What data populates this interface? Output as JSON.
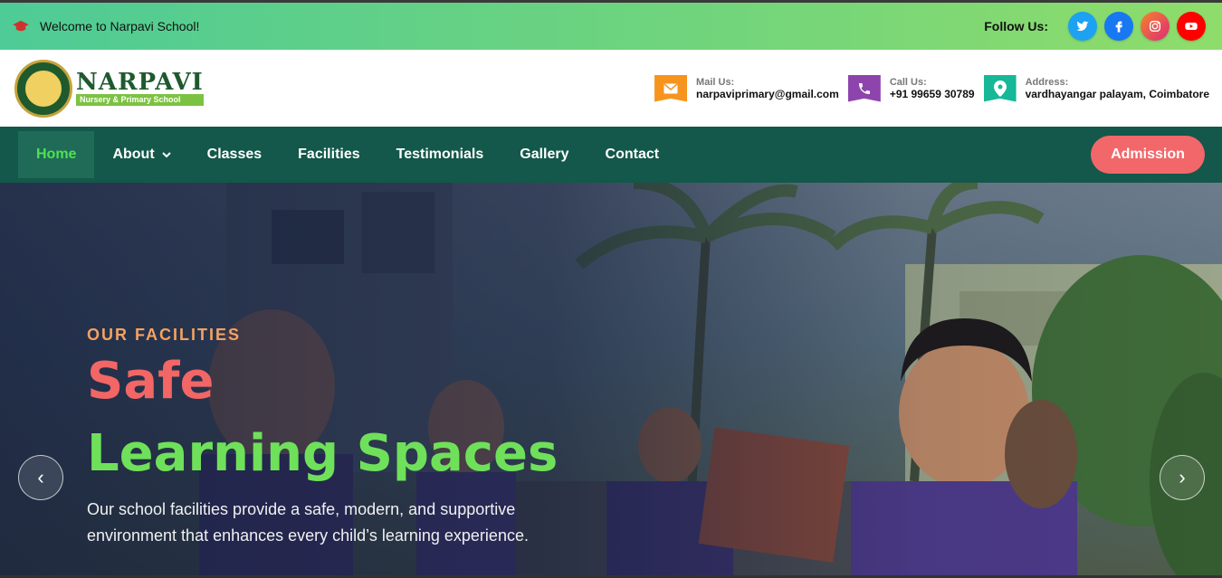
{
  "topbar": {
    "welcome_text": "Welcome to Narpavi School!",
    "follow_label": "Follow Us:",
    "socials": [
      {
        "name": "twitter-icon",
        "color": "#1da1f2"
      },
      {
        "name": "facebook-icon",
        "color": "#1877f2"
      },
      {
        "name": "instagram-icon",
        "color": "#e1306c"
      },
      {
        "name": "youtube-icon",
        "color": "#ff0000"
      }
    ]
  },
  "logo": {
    "name": "NARPAVI",
    "subtitle": "Nursery & Primary School"
  },
  "contacts": {
    "mail": {
      "label": "Mail Us:",
      "value": "narpaviprimary@gmail.com",
      "icon": "mail-icon",
      "color": "#f7941d"
    },
    "call": {
      "label": "Call Us:",
      "value": "+91 99659 30789",
      "icon": "phone-icon",
      "color": "#8e44ad"
    },
    "address": {
      "label": "Address:",
      "value": "vardhayangar palayam, Coimbatore",
      "icon": "map-pin-icon",
      "color": "#17b897"
    }
  },
  "nav": {
    "items": [
      {
        "label": "Home"
      },
      {
        "label": "About"
      },
      {
        "label": "Classes"
      },
      {
        "label": "Facilities"
      },
      {
        "label": "Testimonials"
      },
      {
        "label": "Gallery"
      },
      {
        "label": "Contact"
      }
    ],
    "admission_label": "Admission"
  },
  "hero": {
    "eyebrow": "OUR FACILITIES",
    "title_line1": "Safe",
    "title_line2": "Learning Spaces",
    "description": "Our school facilities provide a safe, modern, and supportive environment that enhances every child’s learning experience.",
    "prev_symbol": "‹",
    "next_symbol": "›"
  }
}
